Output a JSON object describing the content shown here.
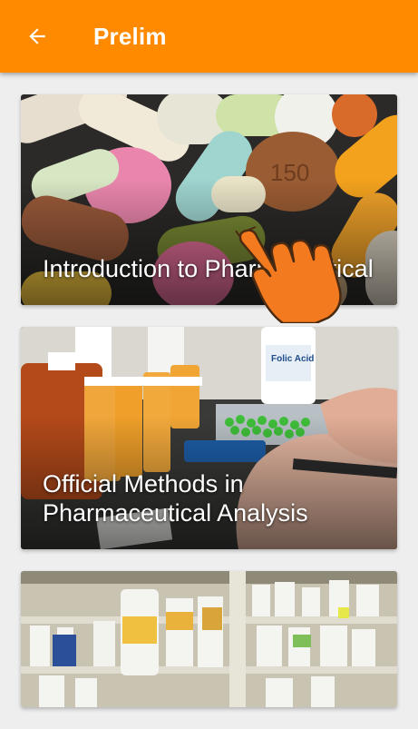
{
  "appbar": {
    "back_icon": "arrow-left-icon",
    "title": "Prelim",
    "color": "#ff8a00"
  },
  "courses": [
    {
      "title": "Introduction to Pharmaceutical",
      "image": "pills-image"
    },
    {
      "title": "Official Methods in Pharmaceutical Analysis",
      "image": "pharmacy-counting-image"
    },
    {
      "title": "",
      "image": "pharmacy-shelves-image"
    }
  ],
  "overlay": {
    "icon": "tap-hand-icon",
    "color": "#f47a1f"
  }
}
